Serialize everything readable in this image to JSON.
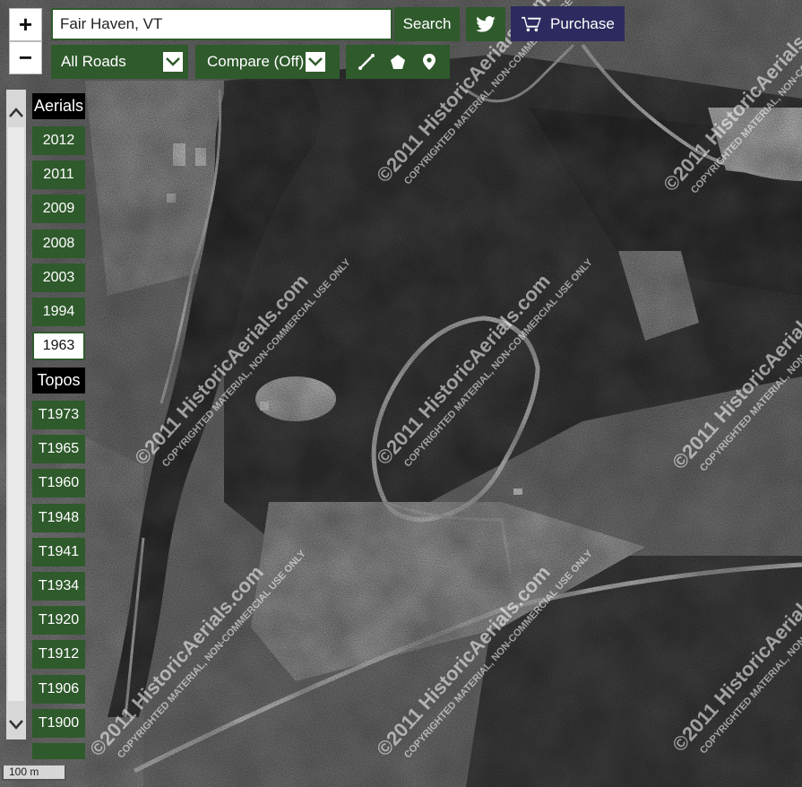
{
  "search": {
    "value": "Fair Haven, VT",
    "button": "Search"
  },
  "zoom": {
    "in": "+",
    "out": "−"
  },
  "purchase_label": "Purchase",
  "roads_select": "All Roads",
  "compare_select": "Compare (Off)",
  "tools": [
    "line-tool-icon",
    "polygon-tool-icon",
    "marker-tool-icon"
  ],
  "aerials_header": "Aerials",
  "aerial_years": [
    "2012",
    "2011",
    "2009",
    "2008",
    "2003",
    "1994",
    "1963"
  ],
  "selected_year": "1963",
  "topos_header": "Topos",
  "topo_years": [
    "T1973",
    "T1965",
    "T1960",
    "T1948",
    "T1941",
    "T1934",
    "T1920",
    "T1912",
    "T1906",
    "T1900"
  ],
  "scale_label": "100 m",
  "watermark": {
    "line1": "©2011 HistoricAerials.com",
    "line2": "COPYRIGHTED MATERIAL, NON-COMMERCIAL USE ONLY"
  },
  "colors": {
    "accent": "#2f5a2c",
    "purchase": "#2c2a5e"
  }
}
